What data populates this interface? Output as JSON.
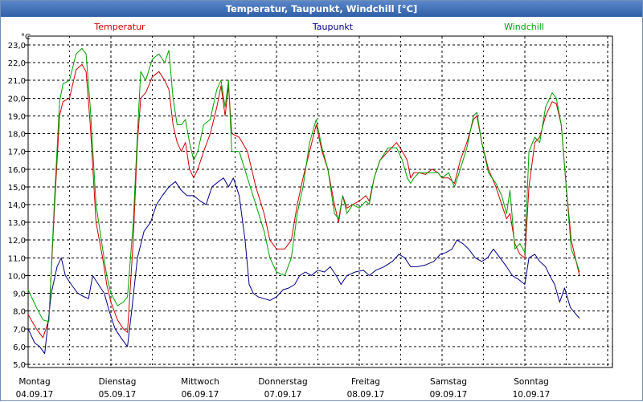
{
  "window": {
    "title": "Temperatur, Taupunkt, Windchill [°C]"
  },
  "chart_data": {
    "type": "line",
    "title": "Temperatur, Taupunkt, Windchill [°C]",
    "unit": "°C",
    "ylim": [
      5.0,
      23.0
    ],
    "yticks": [
      "5,0",
      "6,0",
      "7,0",
      "8,0",
      "9,0",
      "10,0",
      "11,0",
      "12,0",
      "13,0",
      "14,0",
      "15,0",
      "16,0",
      "17,0",
      "18,0",
      "19,0",
      "20,0",
      "21,0",
      "22,0",
      "23,0"
    ],
    "xlim": [
      0,
      7
    ],
    "days": [
      {
        "day": "Montag",
        "date": "04.09.17"
      },
      {
        "day": "Dienstag",
        "date": "05.09.17"
      },
      {
        "day": "Mittwoch",
        "date": "06.09.17"
      },
      {
        "day": "Donnerstag",
        "date": "07.09.17"
      },
      {
        "day": "Freitag",
        "date": "08.09.17"
      },
      {
        "day": "Samstag",
        "date": "09.09.17"
      },
      {
        "day": "Sonntag",
        "date": "10.09.17"
      }
    ],
    "grid": true,
    "series": [
      {
        "name": "Temperatur",
        "color": "#d00000",
        "points": [
          [
            0.0,
            7.8
          ],
          [
            0.1,
            7.0
          ],
          [
            0.18,
            6.5
          ],
          [
            0.25,
            7.5
          ],
          [
            0.32,
            14.0
          ],
          [
            0.38,
            19.0
          ],
          [
            0.42,
            19.8
          ],
          [
            0.5,
            20.0
          ],
          [
            0.58,
            21.6
          ],
          [
            0.65,
            21.9
          ],
          [
            0.7,
            21.5
          ],
          [
            0.75,
            18.5
          ],
          [
            0.82,
            13.0
          ],
          [
            0.9,
            11.0
          ],
          [
            0.95,
            9.5
          ],
          [
            1.0,
            8.5
          ],
          [
            1.08,
            7.5
          ],
          [
            1.15,
            7.0
          ],
          [
            1.2,
            6.8
          ],
          [
            1.27,
            12.0
          ],
          [
            1.32,
            17.5
          ],
          [
            1.36,
            20.0
          ],
          [
            1.42,
            20.3
          ],
          [
            1.5,
            21.2
          ],
          [
            1.58,
            21.5
          ],
          [
            1.65,
            21.0
          ],
          [
            1.7,
            20.5
          ],
          [
            1.75,
            18.5
          ],
          [
            1.8,
            17.5
          ],
          [
            1.85,
            17.0
          ],
          [
            1.9,
            17.5
          ],
          [
            1.95,
            16.0
          ],
          [
            2.0,
            15.5
          ],
          [
            2.05,
            16.0
          ],
          [
            2.12,
            17.0
          ],
          [
            2.2,
            18.0
          ],
          [
            2.28,
            19.5
          ],
          [
            2.33,
            20.7
          ],
          [
            2.38,
            19.0
          ],
          [
            2.42,
            20.7
          ],
          [
            2.46,
            18.0
          ],
          [
            2.55,
            17.8
          ],
          [
            2.65,
            17.0
          ],
          [
            2.75,
            15.0
          ],
          [
            2.85,
            13.5
          ],
          [
            2.92,
            12.0
          ],
          [
            3.0,
            11.5
          ],
          [
            3.1,
            11.5
          ],
          [
            3.18,
            12.0
          ],
          [
            3.25,
            14.0
          ],
          [
            3.32,
            15.5
          ],
          [
            3.4,
            17.0
          ],
          [
            3.48,
            18.5
          ],
          [
            3.55,
            17.0
          ],
          [
            3.62,
            16.0
          ],
          [
            3.7,
            14.0
          ],
          [
            3.75,
            13.0
          ],
          [
            3.8,
            14.5
          ],
          [
            3.85,
            13.8
          ],
          [
            3.92,
            14.0
          ],
          [
            4.0,
            14.2
          ],
          [
            4.08,
            14.5
          ],
          [
            4.12,
            14.2
          ],
          [
            4.18,
            15.5
          ],
          [
            4.25,
            16.5
          ],
          [
            4.35,
            17.0
          ],
          [
            4.45,
            17.5
          ],
          [
            4.52,
            17.0
          ],
          [
            4.58,
            16.5
          ],
          [
            4.62,
            15.5
          ],
          [
            4.66,
            15.8
          ],
          [
            4.72,
            15.8
          ],
          [
            4.8,
            15.7
          ],
          [
            4.88,
            16.0
          ],
          [
            4.95,
            15.8
          ],
          [
            5.0,
            15.5
          ],
          [
            5.08,
            15.5
          ],
          [
            5.15,
            15.2
          ],
          [
            5.22,
            16.5
          ],
          [
            5.3,
            17.5
          ],
          [
            5.38,
            18.8
          ],
          [
            5.42,
            19.0
          ],
          [
            5.48,
            17.5
          ],
          [
            5.56,
            16.0
          ],
          [
            5.65,
            15.0
          ],
          [
            5.72,
            14.0
          ],
          [
            5.78,
            13.2
          ],
          [
            5.82,
            13.5
          ],
          [
            5.88,
            11.8
          ],
          [
            5.94,
            11.2
          ],
          [
            6.0,
            11.0
          ],
          [
            6.05,
            15.0
          ],
          [
            6.12,
            17.5
          ],
          [
            6.18,
            17.8
          ],
          [
            6.25,
            19.0
          ],
          [
            6.33,
            19.8
          ],
          [
            6.38,
            19.7
          ],
          [
            6.44,
            18.5
          ],
          [
            6.5,
            15.0
          ],
          [
            6.56,
            12.0
          ],
          [
            6.62,
            10.8
          ],
          [
            6.66,
            10.0
          ]
        ]
      },
      {
        "name": "Taupunkt",
        "color": "#00008c",
        "points": [
          [
            0.0,
            7.0
          ],
          [
            0.08,
            6.2
          ],
          [
            0.14,
            6.0
          ],
          [
            0.2,
            5.6
          ],
          [
            0.28,
            9.0
          ],
          [
            0.35,
            10.5
          ],
          [
            0.4,
            11.0
          ],
          [
            0.45,
            10.0
          ],
          [
            0.52,
            9.5
          ],
          [
            0.6,
            9.0
          ],
          [
            0.68,
            8.8
          ],
          [
            0.73,
            8.7
          ],
          [
            0.78,
            10.0
          ],
          [
            0.85,
            9.5
          ],
          [
            0.92,
            9.0
          ],
          [
            0.98,
            8.0
          ],
          [
            1.05,
            7.0
          ],
          [
            1.12,
            6.5
          ],
          [
            1.2,
            6.0
          ],
          [
            1.25,
            8.0
          ],
          [
            1.32,
            11.0
          ],
          [
            1.4,
            12.5
          ],
          [
            1.48,
            13.0
          ],
          [
            1.55,
            14.0
          ],
          [
            1.62,
            14.5
          ],
          [
            1.7,
            15.0
          ],
          [
            1.78,
            15.3
          ],
          [
            1.85,
            14.8
          ],
          [
            1.92,
            14.5
          ],
          [
            2.0,
            14.5
          ],
          [
            2.08,
            14.2
          ],
          [
            2.15,
            14.0
          ],
          [
            2.22,
            15.0
          ],
          [
            2.3,
            15.3
          ],
          [
            2.36,
            15.5
          ],
          [
            2.42,
            15.0
          ],
          [
            2.48,
            15.5
          ],
          [
            2.55,
            14.5
          ],
          [
            2.62,
            12.0
          ],
          [
            2.67,
            9.5
          ],
          [
            2.72,
            9.0
          ],
          [
            2.78,
            8.8
          ],
          [
            2.85,
            8.7
          ],
          [
            2.92,
            8.6
          ],
          [
            3.0,
            8.8
          ],
          [
            3.08,
            9.2
          ],
          [
            3.15,
            9.3
          ],
          [
            3.22,
            9.5
          ],
          [
            3.28,
            10.0
          ],
          [
            3.35,
            10.2
          ],
          [
            3.42,
            10.0
          ],
          [
            3.5,
            10.3
          ],
          [
            3.58,
            10.2
          ],
          [
            3.65,
            10.5
          ],
          [
            3.72,
            10.0
          ],
          [
            3.78,
            9.5
          ],
          [
            3.85,
            10.0
          ],
          [
            3.95,
            10.2
          ],
          [
            4.05,
            10.3
          ],
          [
            4.12,
            10.0
          ],
          [
            4.2,
            10.3
          ],
          [
            4.3,
            10.5
          ],
          [
            4.4,
            10.8
          ],
          [
            4.48,
            11.2
          ],
          [
            4.55,
            11.0
          ],
          [
            4.62,
            10.5
          ],
          [
            4.7,
            10.5
          ],
          [
            4.8,
            10.6
          ],
          [
            4.9,
            10.8
          ],
          [
            4.98,
            11.2
          ],
          [
            5.05,
            11.3
          ],
          [
            5.12,
            11.5
          ],
          [
            5.18,
            12.0
          ],
          [
            5.25,
            11.8
          ],
          [
            5.32,
            11.5
          ],
          [
            5.4,
            11.0
          ],
          [
            5.48,
            10.8
          ],
          [
            5.55,
            11.0
          ],
          [
            5.62,
            11.5
          ],
          [
            5.7,
            11.0
          ],
          [
            5.78,
            10.5
          ],
          [
            5.85,
            10.0
          ],
          [
            5.92,
            9.8
          ],
          [
            6.0,
            9.5
          ],
          [
            6.05,
            11.0
          ],
          [
            6.12,
            11.2
          ],
          [
            6.18,
            10.8
          ],
          [
            6.25,
            10.5
          ],
          [
            6.3,
            10.0
          ],
          [
            6.36,
            9.5
          ],
          [
            6.42,
            8.5
          ],
          [
            6.48,
            9.3
          ],
          [
            6.55,
            8.2
          ],
          [
            6.62,
            7.8
          ],
          [
            6.66,
            7.6
          ]
        ]
      },
      {
        "name": "Windchill",
        "color": "#00a000",
        "points": [
          [
            0.0,
            9.2
          ],
          [
            0.1,
            8.2
          ],
          [
            0.18,
            7.5
          ],
          [
            0.25,
            7.4
          ],
          [
            0.32,
            14.5
          ],
          [
            0.38,
            19.8
          ],
          [
            0.42,
            20.8
          ],
          [
            0.5,
            21.0
          ],
          [
            0.58,
            22.5
          ],
          [
            0.65,
            22.8
          ],
          [
            0.7,
            22.5
          ],
          [
            0.75,
            19.5
          ],
          [
            0.82,
            14.0
          ],
          [
            0.9,
            11.5
          ],
          [
            0.95,
            10.0
          ],
          [
            1.0,
            9.0
          ],
          [
            1.08,
            8.3
          ],
          [
            1.15,
            8.5
          ],
          [
            1.2,
            8.8
          ],
          [
            1.27,
            13.0
          ],
          [
            1.32,
            18.0
          ],
          [
            1.36,
            21.5
          ],
          [
            1.42,
            21.0
          ],
          [
            1.5,
            22.2
          ],
          [
            1.58,
            22.5
          ],
          [
            1.65,
            22.0
          ],
          [
            1.7,
            22.7
          ],
          [
            1.75,
            20.0
          ],
          [
            1.8,
            18.5
          ],
          [
            1.85,
            18.5
          ],
          [
            1.9,
            18.8
          ],
          [
            1.95,
            17.5
          ],
          [
            2.0,
            16.5
          ],
          [
            2.05,
            17.0
          ],
          [
            2.12,
            18.5
          ],
          [
            2.2,
            18.8
          ],
          [
            2.28,
            20.5
          ],
          [
            2.33,
            21.0
          ],
          [
            2.38,
            19.5
          ],
          [
            2.42,
            21.0
          ],
          [
            2.46,
            17.0
          ],
          [
            2.55,
            17.0
          ],
          [
            2.65,
            15.5
          ],
          [
            2.75,
            14.0
          ],
          [
            2.85,
            12.5
          ],
          [
            2.92,
            11.0
          ],
          [
            3.0,
            10.2
          ],
          [
            3.1,
            10.0
          ],
          [
            3.18,
            11.0
          ],
          [
            3.25,
            13.5
          ],
          [
            3.32,
            15.0
          ],
          [
            3.4,
            17.5
          ],
          [
            3.48,
            18.8
          ],
          [
            3.55,
            17.2
          ],
          [
            3.62,
            16.0
          ],
          [
            3.7,
            13.5
          ],
          [
            3.75,
            13.2
          ],
          [
            3.8,
            14.5
          ],
          [
            3.85,
            13.5
          ],
          [
            3.92,
            14.0
          ],
          [
            4.0,
            13.8
          ],
          [
            4.08,
            14.2
          ],
          [
            4.12,
            14.0
          ],
          [
            4.18,
            15.5
          ],
          [
            4.25,
            16.5
          ],
          [
            4.35,
            17.2
          ],
          [
            4.45,
            17.2
          ],
          [
            4.52,
            16.5
          ],
          [
            4.58,
            15.5
          ],
          [
            4.62,
            15.2
          ],
          [
            4.66,
            15.5
          ],
          [
            4.72,
            15.8
          ],
          [
            4.8,
            15.8
          ],
          [
            4.88,
            15.8
          ],
          [
            4.95,
            15.8
          ],
          [
            5.0,
            15.5
          ],
          [
            5.08,
            15.8
          ],
          [
            5.15,
            15.0
          ],
          [
            5.22,
            16.0
          ],
          [
            5.3,
            17.2
          ],
          [
            5.38,
            19.0
          ],
          [
            5.42,
            19.2
          ],
          [
            5.48,
            17.5
          ],
          [
            5.56,
            15.8
          ],
          [
            5.65,
            15.2
          ],
          [
            5.72,
            14.5
          ],
          [
            5.78,
            13.5
          ],
          [
            5.82,
            14.8
          ],
          [
            5.88,
            11.5
          ],
          [
            5.94,
            11.8
          ],
          [
            6.0,
            11.3
          ],
          [
            6.05,
            17.0
          ],
          [
            6.12,
            17.8
          ],
          [
            6.18,
            17.5
          ],
          [
            6.25,
            19.5
          ],
          [
            6.33,
            20.3
          ],
          [
            6.38,
            20.0
          ],
          [
            6.44,
            18.5
          ],
          [
            6.5,
            15.0
          ],
          [
            6.56,
            11.5
          ],
          [
            6.62,
            10.8
          ],
          [
            6.66,
            10.2
          ]
        ]
      }
    ]
  }
}
